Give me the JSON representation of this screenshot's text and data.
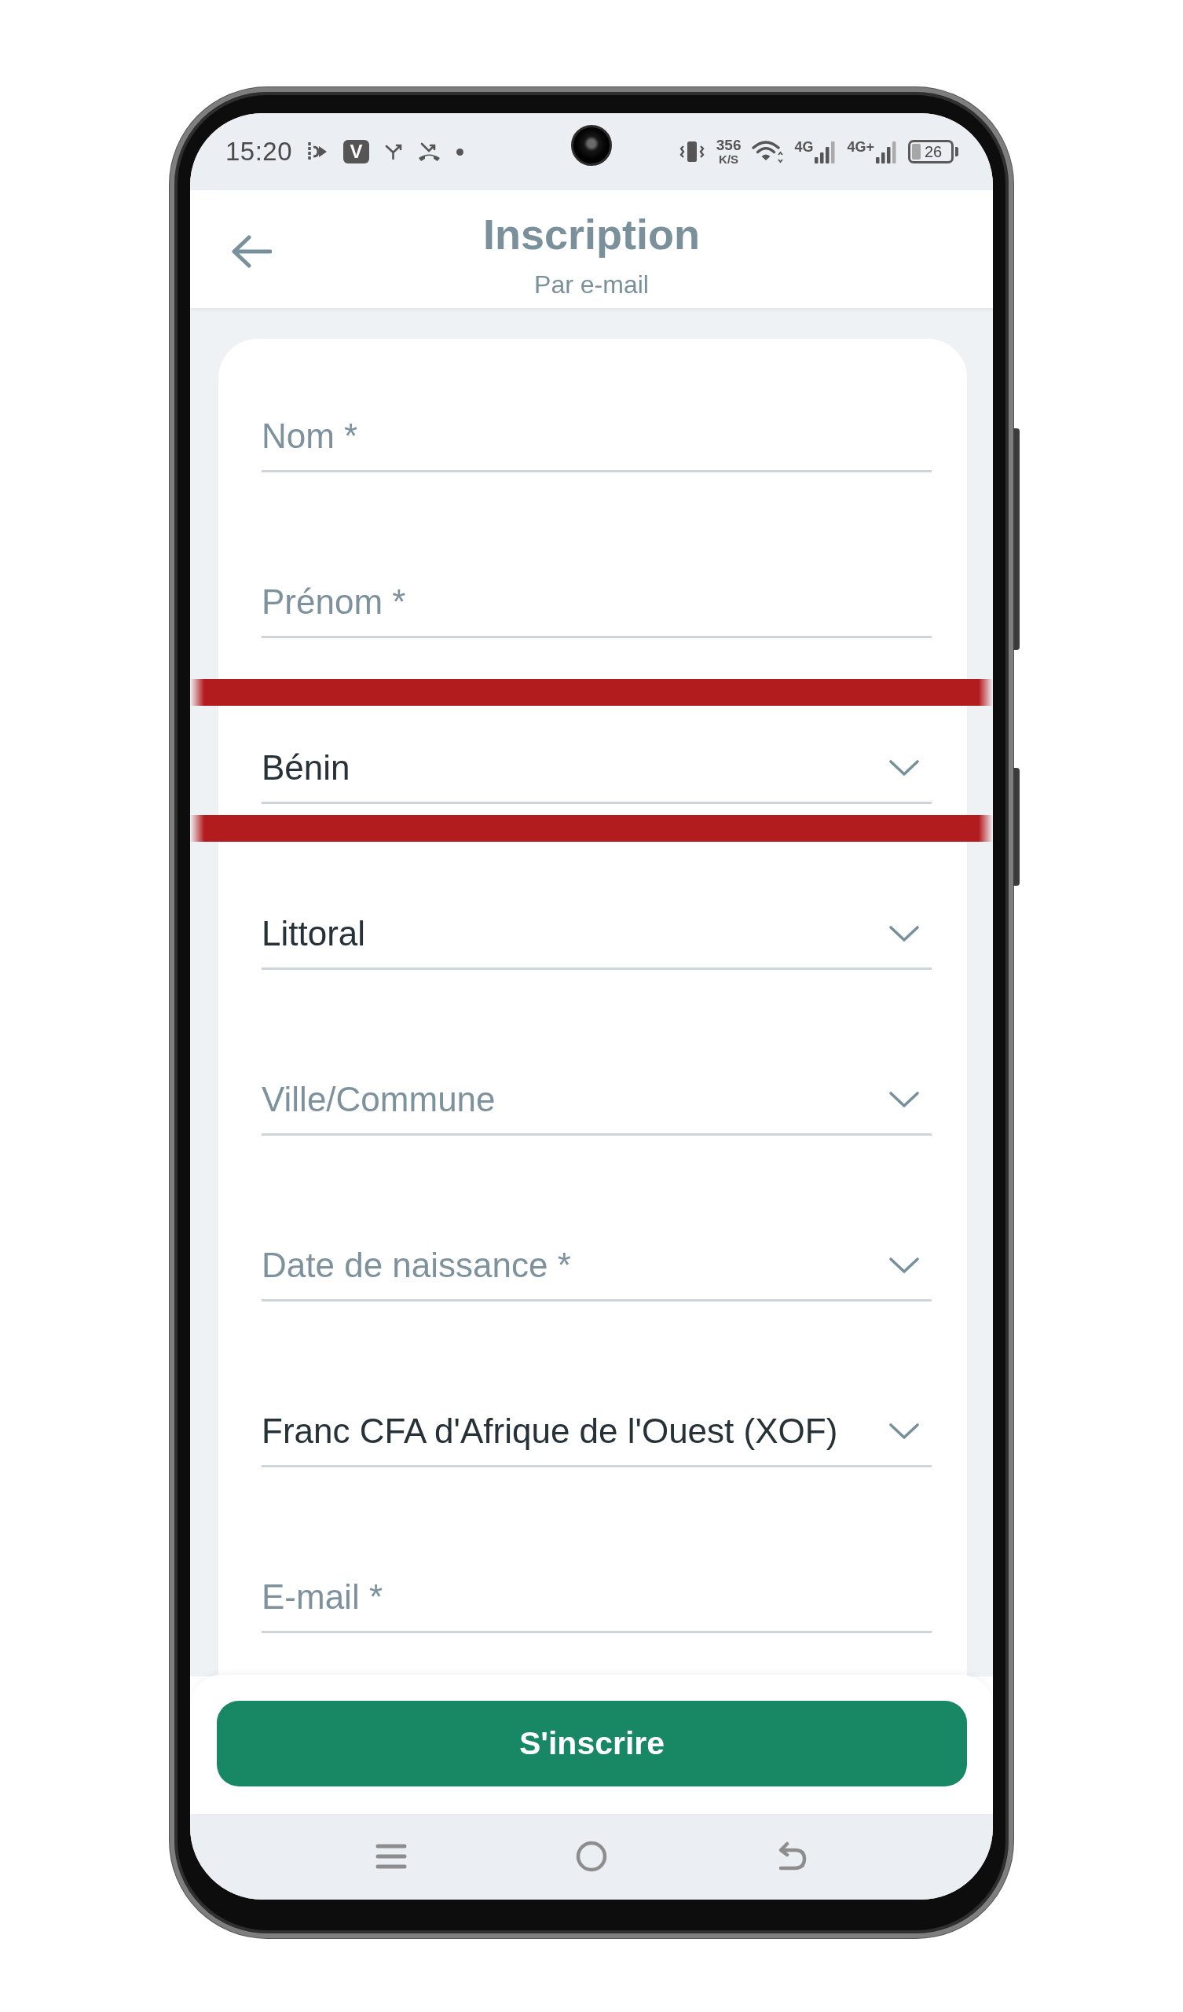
{
  "status_bar": {
    "time": "15:20",
    "app_badge": "V",
    "net_speed": {
      "value": "356",
      "unit": "K/S"
    },
    "networks": [
      "4G",
      "4G+"
    ],
    "battery": "26"
  },
  "header": {
    "title": "Inscription",
    "subtitle": "Par e-mail"
  },
  "form": {
    "fields": [
      {
        "kind": "text",
        "placeholder": "Nom *",
        "highlighted": false
      },
      {
        "kind": "text",
        "placeholder": "Prénom *",
        "highlighted": false
      },
      {
        "kind": "select",
        "value": "Bénin",
        "highlighted": true
      },
      {
        "kind": "select",
        "value": "Littoral",
        "highlighted": false
      },
      {
        "kind": "select",
        "placeholder": "Ville/Commune",
        "highlighted": false
      },
      {
        "kind": "select",
        "placeholder": "Date de naissance *",
        "highlighted": false
      },
      {
        "kind": "select",
        "value": "Franc CFA d'Afrique de l'Ouest (XOF)",
        "highlighted": false
      },
      {
        "kind": "text",
        "placeholder": "E-mail *",
        "highlighted": false
      }
    ]
  },
  "submit_button": {
    "label": "S'inscrire"
  }
}
